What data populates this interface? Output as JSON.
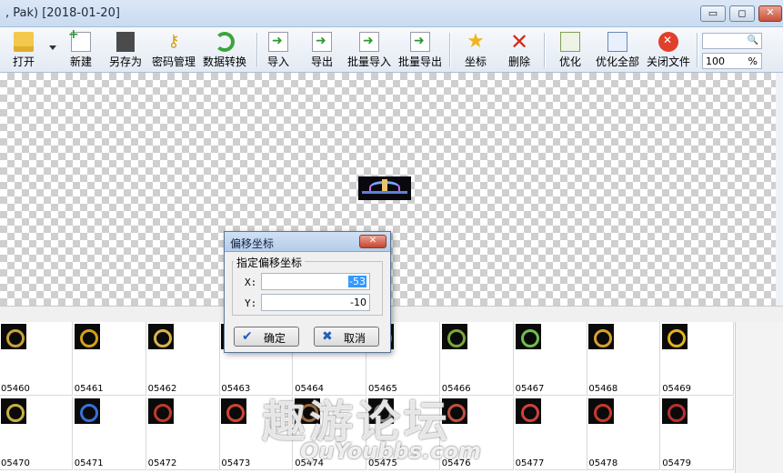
{
  "window": {
    "title": ", Pak) [2018-01-20]",
    "minimize_glyph": "▭",
    "maximize_glyph": "◻",
    "close_glyph": "✕"
  },
  "toolbar": {
    "open": "打开",
    "new": "新建",
    "save_as": "另存为",
    "password": "密码管理",
    "convert": "数据转换",
    "import": "导入",
    "export": "导出",
    "batch_import": "批量导入",
    "batch_export": "批量导出",
    "coords": "坐标",
    "delete": "删除",
    "optimize": "优化",
    "optimize_all": "优化全部",
    "close_file": "关闭文件",
    "search_value": "",
    "zoom_value": "100",
    "zoom_unit": "%"
  },
  "dialog": {
    "title": "偏移坐标",
    "group_label": "指定偏移坐标",
    "x_label": "X:",
    "x_value": "-53",
    "y_label": "Y:",
    "y_value": "-10",
    "ok_label": "确定",
    "cancel_label": "取消"
  },
  "thumbnails": [
    {
      "id": "05460",
      "color": "#c9a23a"
    },
    {
      "id": "05461",
      "color": "#d4a017"
    },
    {
      "id": "05462",
      "color": "#d9b44a"
    },
    {
      "id": "05463",
      "color": "#b84a2a"
    },
    {
      "id": "05464",
      "color": "#8a6d3b"
    },
    {
      "id": "05465",
      "color": "#9b8a55"
    },
    {
      "id": "05466",
      "color": "#7aa83a"
    },
    {
      "id": "05467",
      "color": "#6fbf4a"
    },
    {
      "id": "05468",
      "color": "#d8a030"
    },
    {
      "id": "05469",
      "color": "#e3b21e"
    },
    {
      "id": "05470",
      "color": "#c8b040"
    },
    {
      "id": "05471",
      "color": "#3a6fd8"
    },
    {
      "id": "05472",
      "color": "#c0392b"
    },
    {
      "id": "05473",
      "color": "#d0452f"
    },
    {
      "id": "05474",
      "color": "#9a6a3a"
    },
    {
      "id": "05475",
      "color": "#8a8a8a"
    },
    {
      "id": "05476",
      "color": "#c05040"
    },
    {
      "id": "05477",
      "color": "#d04040"
    },
    {
      "id": "05478",
      "color": "#c8382a"
    },
    {
      "id": "05479",
      "color": "#b83030"
    }
  ],
  "watermark": {
    "main": "趣游论坛",
    "sub": "QuYoubbs.com"
  }
}
